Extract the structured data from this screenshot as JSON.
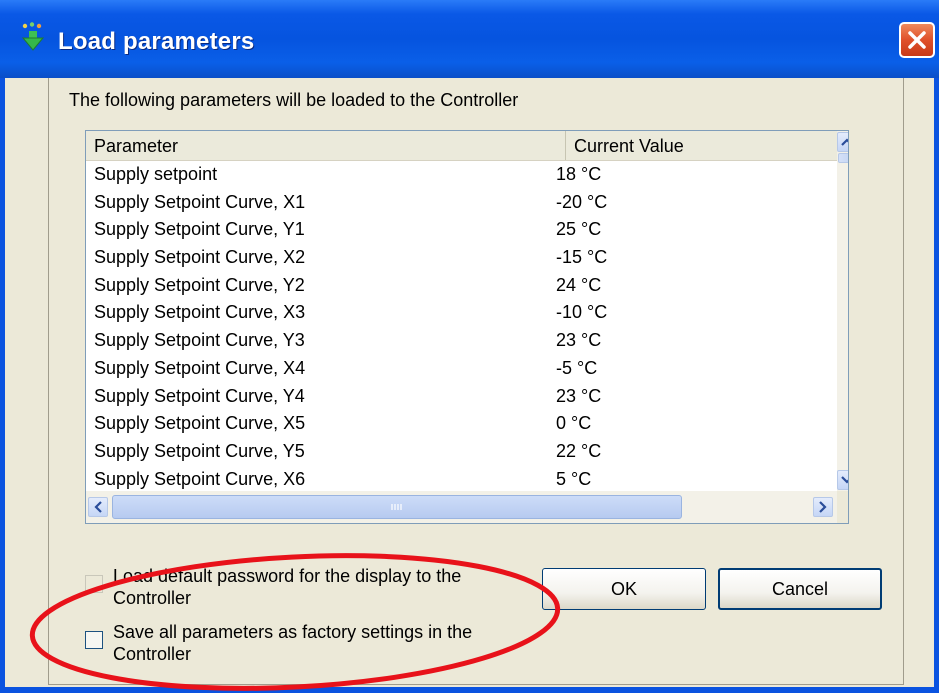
{
  "window": {
    "title": "Load parameters",
    "icon": "load-arrow-icon",
    "close_icon": "close-icon"
  },
  "intro": "The following parameters will be loaded to the Controller",
  "table": {
    "columns": [
      "Parameter",
      "Current Value"
    ],
    "rows": [
      {
        "parameter": "Supply setpoint",
        "value": "18 °C"
      },
      {
        "parameter": "Supply Setpoint Curve, X1",
        "value": "-20 °C"
      },
      {
        "parameter": "Supply Setpoint Curve, Y1",
        "value": "25 °C"
      },
      {
        "parameter": "Supply Setpoint Curve, X2",
        "value": "-15 °C"
      },
      {
        "parameter": "Supply Setpoint Curve, Y2",
        "value": "24 °C"
      },
      {
        "parameter": "Supply Setpoint Curve, X3",
        "value": "-10 °C"
      },
      {
        "parameter": "Supply Setpoint Curve, Y3",
        "value": "23 °C"
      },
      {
        "parameter": "Supply Setpoint Curve, X4",
        "value": "-5 °C"
      },
      {
        "parameter": "Supply Setpoint Curve, Y4",
        "value": "23 °C"
      },
      {
        "parameter": "Supply Setpoint Curve, X5",
        "value": "0 °C"
      },
      {
        "parameter": "Supply Setpoint Curve, Y5",
        "value": "22 °C"
      },
      {
        "parameter": "Supply Setpoint Curve, X6",
        "value": "5 °C"
      }
    ]
  },
  "options": {
    "load_default_password": {
      "label": "Load default password for the display to the Controller",
      "checked": false,
      "enabled": false
    },
    "save_factory": {
      "label": "Save all parameters as factory settings in the Controller",
      "checked": false,
      "enabled": true
    }
  },
  "buttons": {
    "ok": "OK",
    "cancel": "Cancel"
  },
  "colors": {
    "titlebar": "#0654df",
    "client": "#ece9d8",
    "close": "#e0502a",
    "annotation": "#e8121a"
  }
}
